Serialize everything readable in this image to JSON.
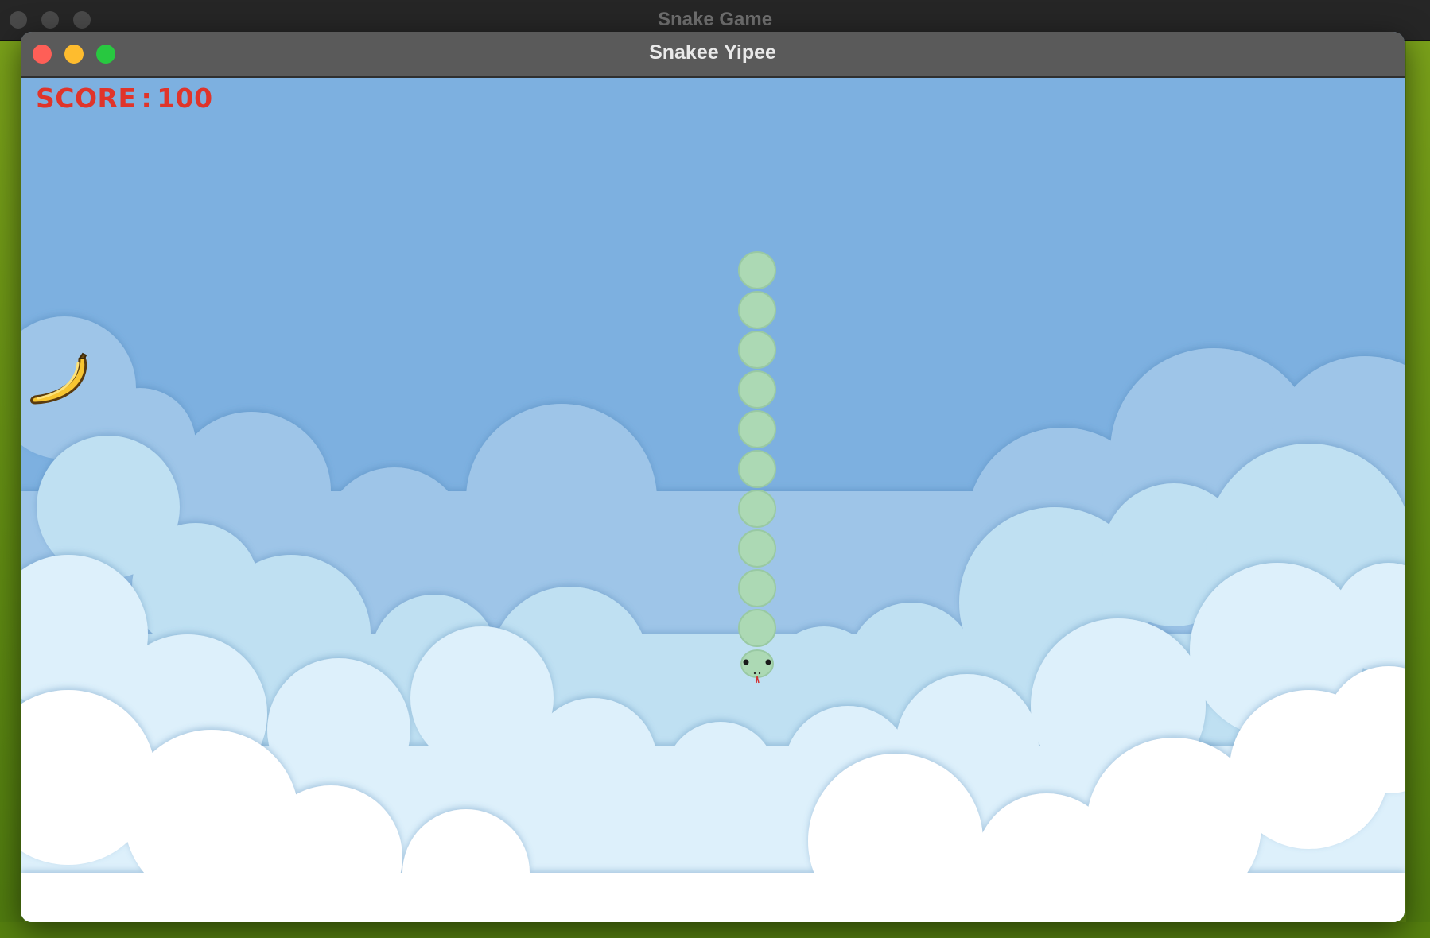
{
  "background_window": {
    "title": "Snake Game"
  },
  "game_window": {
    "title": "Snakee Yipee"
  },
  "hud": {
    "score_label": "SCORE",
    "score_separator": ":",
    "score_value": "100"
  },
  "game": {
    "food": "banana",
    "snake_color": "#acd9b4",
    "snake_segments_body": 10,
    "direction": "down"
  },
  "colors": {
    "sky": "#7db0e0",
    "score_text": "#e0342a",
    "close": "#fe5f57",
    "minimize": "#febc2e",
    "maximize": "#28c840"
  }
}
